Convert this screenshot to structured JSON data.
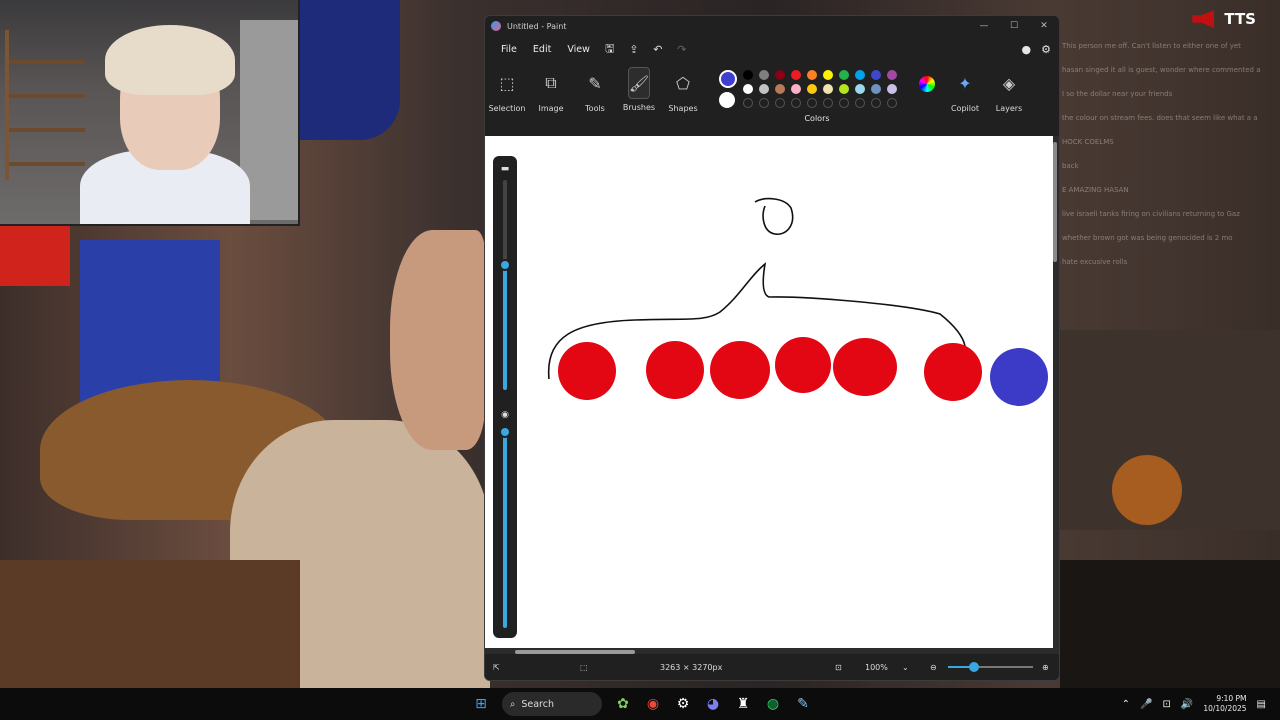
{
  "overlay": {
    "tts_label": "TTS"
  },
  "chat_lines": [
    "This person me off. Can't listen to either one of yet",
    "hasan singed it all is guest, wonder where commented a",
    "I so the dollar near your friends",
    "the colour on stream fees. does that seem like what a a",
    "HOCK COELMS",
    "back",
    "E AMAZING HASAN",
    "live israeli tanks firing on civilians returning to Gaz",
    "whether brown got was being genocided is 2 mo",
    "hate excusive rolls"
  ],
  "window": {
    "title": "Untitled - Paint",
    "controls": [
      "—",
      "☐",
      "✕"
    ]
  },
  "menu": {
    "file": "File",
    "edit": "Edit",
    "view": "View"
  },
  "toolbar_icons": {
    "save": "save-icon",
    "share": "share-icon",
    "undo": "undo-icon",
    "redo": "redo-icon"
  },
  "ribbon": {
    "selection": "Selection",
    "image": "Image",
    "tools": "Tools",
    "brushes": "Brushes",
    "shapes": "Shapes",
    "colors": "Colors",
    "copilot": "Copilot",
    "layers": "Layers"
  },
  "colors": {
    "primary": "#3f3fd0",
    "secondary": "#ffffff",
    "palette_row1": [
      "#000000",
      "#7f7f7f",
      "#880015",
      "#ed1c24",
      "#ff7f27",
      "#fff200",
      "#22b14c",
      "#00a2e8",
      "#3f48cc",
      "#a349a4"
    ],
    "palette_row2": [
      "#ffffff",
      "#c3c3c3",
      "#b97a57",
      "#ffaec9",
      "#ffc90e",
      "#efe4b0",
      "#b5e61d",
      "#99d9ea",
      "#7092be",
      "#c8bfe7"
    ],
    "custom_slots": 10
  },
  "drawing": {
    "red_circle_color": "#e30613",
    "blue_circle_color": "#3b3bc8",
    "red_circles": 6,
    "blue_circles": 1
  },
  "status": {
    "canvas_size": "3263 × 3270px",
    "zoom": "100%",
    "zoom_level": 0.3
  },
  "taskbar": {
    "search_label": "Search",
    "time": "9:10 PM",
    "date": "10/10/2025"
  }
}
